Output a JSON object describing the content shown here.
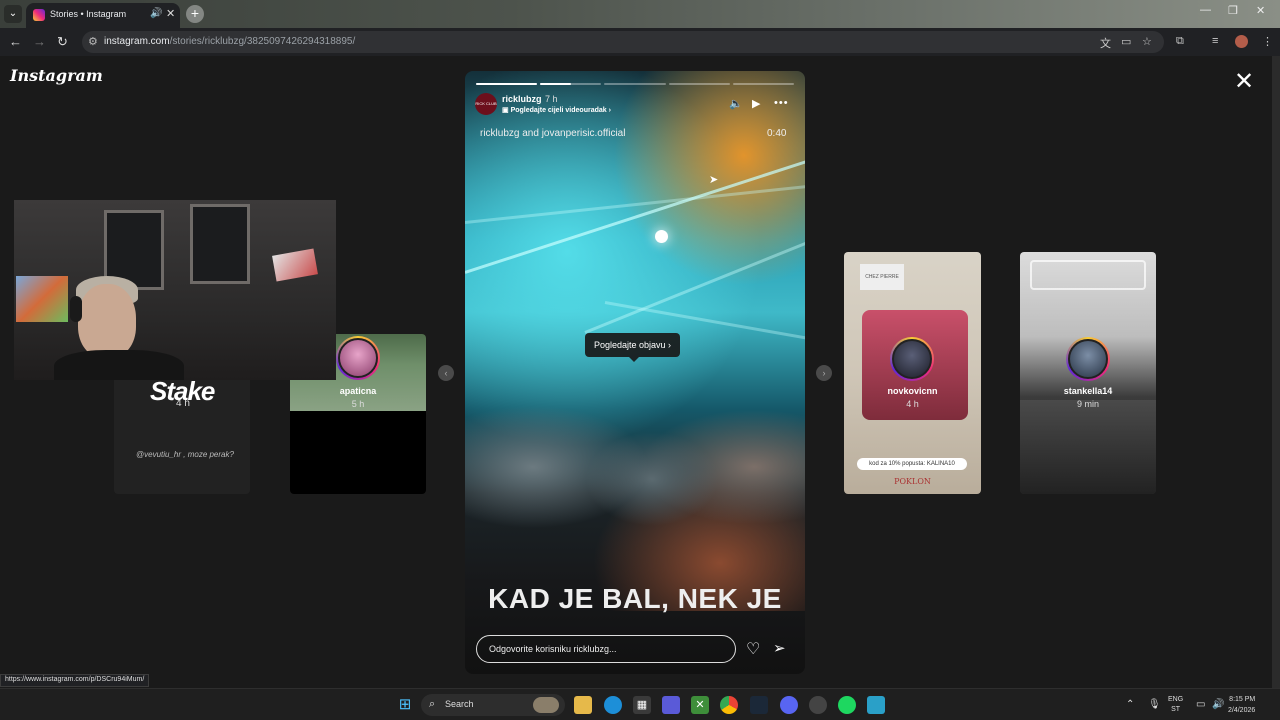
{
  "browser": {
    "tab_title": "Stories • Instagram",
    "new_tab_symbol": "+",
    "url_host": "instagram.com",
    "url_path": "/stories/ricklubzg/3825097426294318895/",
    "status_url": "https://www.instagram.com/p/DSCru94iMum/"
  },
  "page": {
    "logo_text": "Instagram",
    "close_symbol": "✕"
  },
  "overlay": {
    "stake_text": "Stake"
  },
  "side_stories": {
    "left_dim": {
      "time": "4 h",
      "caption": "@vevutiu_hr , moze perak?"
    },
    "apaticna": {
      "username": "apaticna",
      "time": "5 h"
    },
    "novkovicnn": {
      "username": "novkovicnn",
      "time": "4 h",
      "brand": "CHEZ PIERRE",
      "promo": "kod za 10% popusta: KALINA10",
      "poklon": "POKLON"
    },
    "stankella": {
      "username": "stankella14",
      "time": "9 min"
    }
  },
  "story": {
    "username": "ricklubzg",
    "avatar_text": "RICK CLUB",
    "time": "7 h",
    "sublink": "Pogledajte cijeli videouradak ›",
    "collab": "ricklubzg and jovanperisic.official",
    "duration": "0:40",
    "view_post": "Pogledajte objavu  ›",
    "headline": "KAD JE BAL, NEK JE",
    "reply_placeholder": "Odgovorite korisniku ricklubzg...",
    "progress": [
      1,
      0.5,
      0,
      0,
      0
    ]
  },
  "taskbar": {
    "search_label": "Search",
    "lang_top": "ENG",
    "lang_bottom": "ST",
    "time": "8:15 PM",
    "date": "2/4/2026"
  },
  "colors": {
    "instagram_gradient": [
      "#f9ce34",
      "#ee2a7b",
      "#6228d7"
    ],
    "page_bg": "#1a1a1a"
  }
}
